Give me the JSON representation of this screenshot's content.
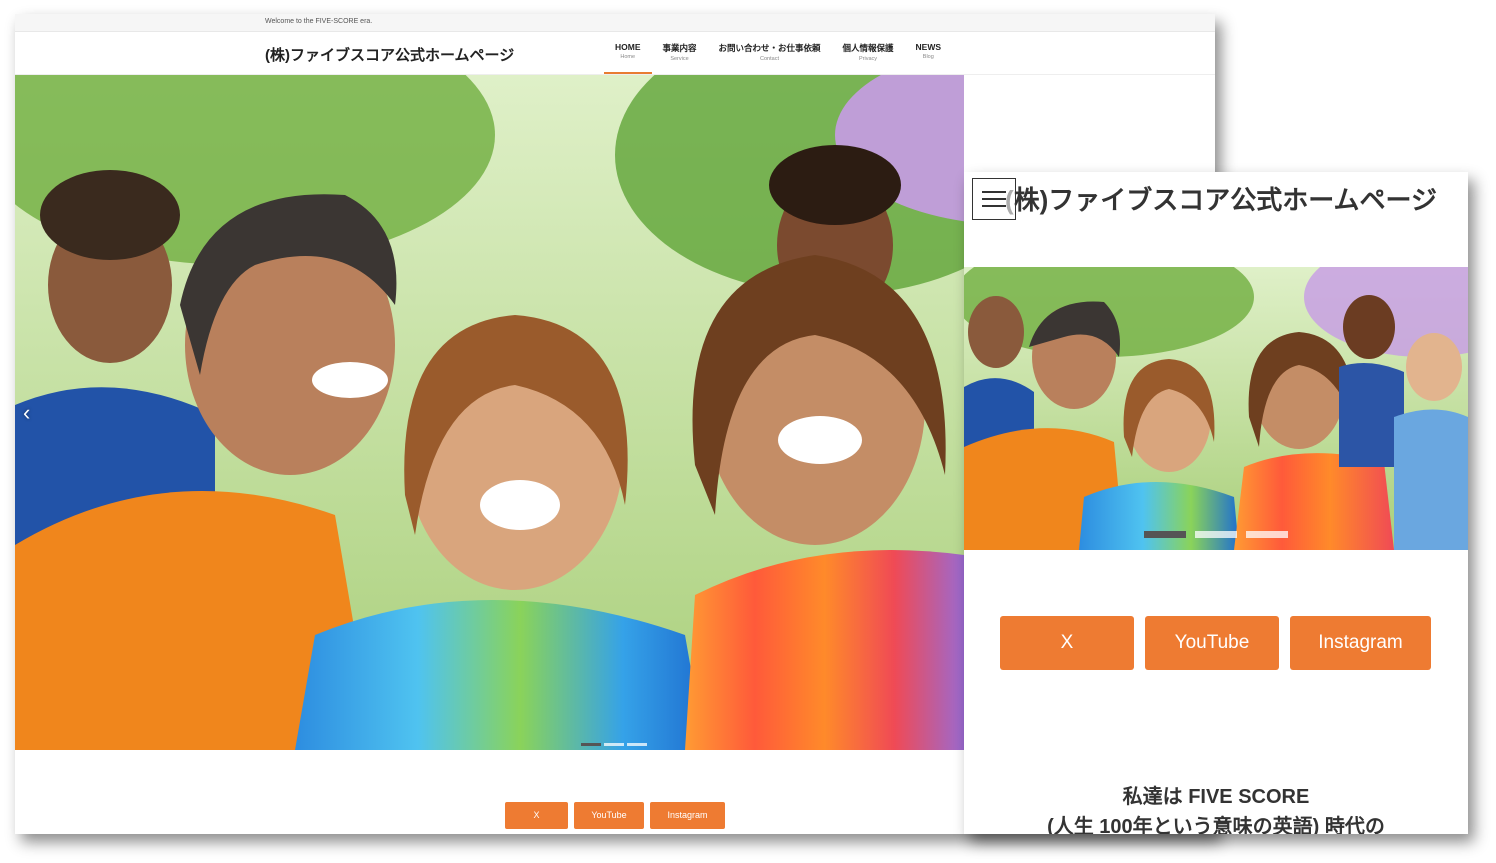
{
  "desktop": {
    "topbar_text": "Welcome to the FIVE-SCORE era.",
    "site_title": "(株)ファイブスコア公式ホームページ",
    "nav": [
      {
        "label": "HOME",
        "sub": "Home",
        "active": true
      },
      {
        "label": "事業内容",
        "sub": "Service",
        "active": false
      },
      {
        "label": "お問い合わせ・お仕事依頼",
        "sub": "Contact",
        "active": false
      },
      {
        "label": "個人情報保護",
        "sub": "Privacy",
        "active": false
      },
      {
        "label": "NEWS",
        "sub": "Blog",
        "active": false
      }
    ],
    "slider_prev_icon": "‹",
    "sns_buttons": [
      "X",
      "YouTube",
      "Instagram"
    ]
  },
  "mobile": {
    "site_title": "(株)ファイブスコア公式ホームページ",
    "sns_buttons": [
      "X",
      "YouTube",
      "Instagram"
    ],
    "catch_line1": "私達は FIVE SCORE",
    "catch_line2": "(人生 100年という意味の英語) 時代の"
  },
  "colors": {
    "accent": "#ee7b32",
    "nav_active_underline": "#e87c32"
  },
  "slider": {
    "slides": 3,
    "active_index": 0
  }
}
